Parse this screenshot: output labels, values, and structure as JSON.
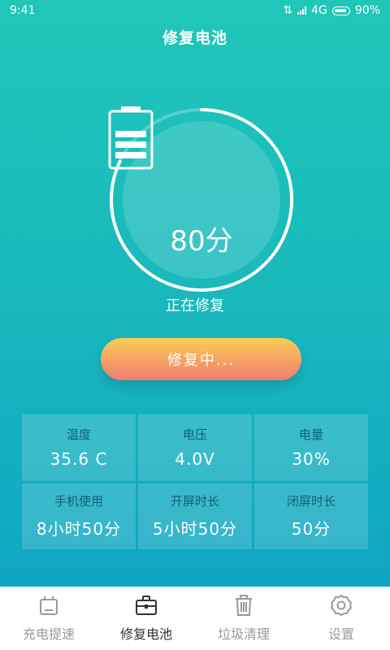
{
  "status_bar": {
    "time": "9:41",
    "network": "4G",
    "battery": "90%"
  },
  "header": {
    "title": "修复电池"
  },
  "gauge": {
    "score": "80分",
    "progress_fraction": 0.82,
    "status": "正在修复"
  },
  "action": {
    "button_label": "修复中..."
  },
  "stats": [
    {
      "label": "温度",
      "value": "35.6  C"
    },
    {
      "label": "电压",
      "value": "4.0V"
    },
    {
      "label": "电量",
      "value": "30%"
    },
    {
      "label": "手机使用",
      "value": "8小时50分"
    },
    {
      "label": "开屏时长",
      "value": "5小时50分"
    },
    {
      "label": "闭屏时长",
      "value": "50分"
    }
  ],
  "tabs": [
    {
      "label": "充电提速",
      "icon": "charging-icon",
      "active": false
    },
    {
      "label": "修复电池",
      "icon": "toolbox-icon",
      "active": true
    },
    {
      "label": "垃圾清理",
      "icon": "trash-icon",
      "active": false
    },
    {
      "label": "设置",
      "icon": "gear-icon",
      "active": false
    }
  ],
  "colors": {
    "gradient_top": "#20c7b8",
    "gradient_bottom": "#10a5c3",
    "button_top": "#f8cf56",
    "button_bottom": "#ef7e72"
  }
}
